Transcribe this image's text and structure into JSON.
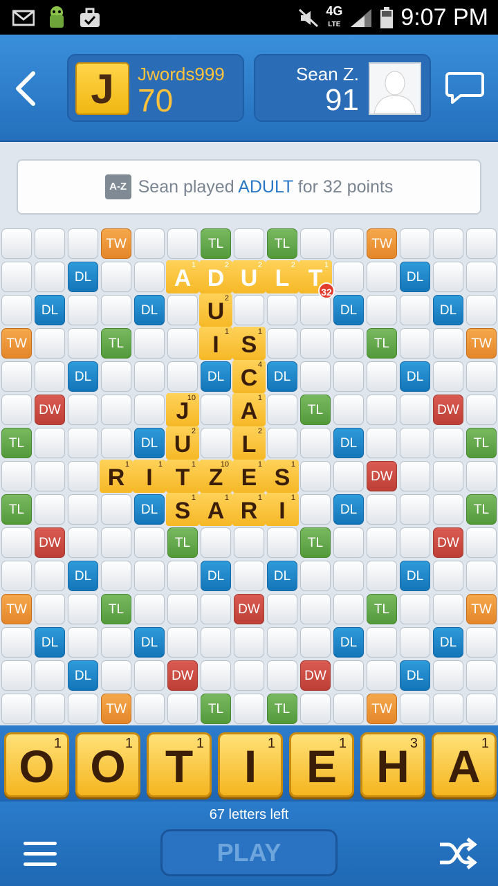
{
  "status_bar": {
    "time": "9:07 PM",
    "network": "4G",
    "network_sub": "LTE",
    "icons": [
      "mail-icon",
      "android-icon",
      "briefcase-check-icon",
      "mute-icon",
      "signal-icon",
      "battery-icon"
    ]
  },
  "players": {
    "me": {
      "initial": "J",
      "name": "Jwords999",
      "score": "70"
    },
    "opponent": {
      "name": "Sean Z.",
      "score": "91"
    }
  },
  "notice": {
    "icon_label": "A-Z",
    "prefix": "Sean played ",
    "word": "ADULT",
    "suffix": " for 32 points"
  },
  "colors": {
    "tw": "#e4862a",
    "tl": "#539a3c",
    "dl": "#1475b9",
    "dw": "#bd3e35",
    "header": "#2470bd",
    "tile": "#f6b826"
  },
  "board": {
    "size": 15,
    "bonus_rows": [
      "...TW..TL.TL..TW...",
      "x"
    ],
    "premium": [
      {
        "r": 0,
        "c": 3,
        "t": "TW"
      },
      {
        "r": 0,
        "c": 6,
        "t": "TL"
      },
      {
        "r": 0,
        "c": 8,
        "t": "TL"
      },
      {
        "r": 0,
        "c": 11,
        "t": "TW"
      },
      {
        "r": 1,
        "c": 2,
        "t": "DL"
      },
      {
        "r": 1,
        "c": 5,
        "t": "DW"
      },
      {
        "r": 1,
        "c": 9,
        "t": "DW"
      },
      {
        "r": 1,
        "c": 12,
        "t": "DL"
      },
      {
        "r": 2,
        "c": 1,
        "t": "DL"
      },
      {
        "r": 2,
        "c": 4,
        "t": "DL"
      },
      {
        "r": 2,
        "c": 10,
        "t": "DL"
      },
      {
        "r": 2,
        "c": 13,
        "t": "DL"
      },
      {
        "r": 3,
        "c": 0,
        "t": "TW"
      },
      {
        "r": 3,
        "c": 3,
        "t": "TL"
      },
      {
        "r": 3,
        "c": 7,
        "t": "TW"
      },
      {
        "r": 3,
        "c": 11,
        "t": "TL"
      },
      {
        "r": 3,
        "c": 14,
        "t": "TW"
      },
      {
        "r": 4,
        "c": 2,
        "t": "DL"
      },
      {
        "r": 4,
        "c": 6,
        "t": "DL"
      },
      {
        "r": 4,
        "c": 8,
        "t": "DL"
      },
      {
        "r": 4,
        "c": 12,
        "t": "DL"
      },
      {
        "r": 5,
        "c": 1,
        "t": "DW"
      },
      {
        "r": 5,
        "c": 5,
        "t": "TL"
      },
      {
        "r": 5,
        "c": 9,
        "t": "TL"
      },
      {
        "r": 5,
        "c": 13,
        "t": "DW"
      },
      {
        "r": 6,
        "c": 0,
        "t": "TL"
      },
      {
        "r": 6,
        "c": 4,
        "t": "DL"
      },
      {
        "r": 6,
        "c": 10,
        "t": "DL"
      },
      {
        "r": 6,
        "c": 14,
        "t": "TL"
      },
      {
        "r": 7,
        "c": 3,
        "t": "DW"
      },
      {
        "r": 7,
        "c": 11,
        "t": "DW"
      },
      {
        "r": 8,
        "c": 0,
        "t": "TL"
      },
      {
        "r": 8,
        "c": 4,
        "t": "DL"
      },
      {
        "r": 8,
        "c": 10,
        "t": "DL"
      },
      {
        "r": 8,
        "c": 14,
        "t": "TL"
      },
      {
        "r": 9,
        "c": 1,
        "t": "DW"
      },
      {
        "r": 9,
        "c": 5,
        "t": "TL"
      },
      {
        "r": 9,
        "c": 9,
        "t": "TL"
      },
      {
        "r": 9,
        "c": 13,
        "t": "DW"
      },
      {
        "r": 10,
        "c": 2,
        "t": "DL"
      },
      {
        "r": 10,
        "c": 6,
        "t": "DL"
      },
      {
        "r": 10,
        "c": 8,
        "t": "DL"
      },
      {
        "r": 10,
        "c": 12,
        "t": "DL"
      },
      {
        "r": 11,
        "c": 0,
        "t": "TW"
      },
      {
        "r": 11,
        "c": 3,
        "t": "TL"
      },
      {
        "r": 11,
        "c": 7,
        "t": "DW"
      },
      {
        "r": 11,
        "c": 11,
        "t": "TL"
      },
      {
        "r": 11,
        "c": 14,
        "t": "TW"
      },
      {
        "r": 12,
        "c": 1,
        "t": "DL"
      },
      {
        "r": 12,
        "c": 4,
        "t": "DL"
      },
      {
        "r": 12,
        "c": 10,
        "t": "DL"
      },
      {
        "r": 12,
        "c": 13,
        "t": "DL"
      },
      {
        "r": 13,
        "c": 2,
        "t": "DL"
      },
      {
        "r": 13,
        "c": 5,
        "t": "DW"
      },
      {
        "r": 13,
        "c": 9,
        "t": "DW"
      },
      {
        "r": 13,
        "c": 12,
        "t": "DL"
      },
      {
        "r": 14,
        "c": 3,
        "t": "TW"
      },
      {
        "r": 14,
        "c": 6,
        "t": "TL"
      },
      {
        "r": 14,
        "c": 8,
        "t": "TL"
      },
      {
        "r": 14,
        "c": 11,
        "t": "TW"
      }
    ],
    "tiles": [
      {
        "r": 1,
        "c": 5,
        "l": "A",
        "p": "1",
        "hl": true
      },
      {
        "r": 1,
        "c": 6,
        "l": "D",
        "p": "2",
        "hl": true
      },
      {
        "r": 1,
        "c": 7,
        "l": "U",
        "p": "2",
        "hl": true
      },
      {
        "r": 1,
        "c": 8,
        "l": "L",
        "p": "2",
        "hl": true
      },
      {
        "r": 1,
        "c": 9,
        "l": "T",
        "p": "1",
        "hl": true
      },
      {
        "r": 2,
        "c": 6,
        "l": "U",
        "p": "2",
        "hl": false
      },
      {
        "r": 3,
        "c": 6,
        "l": "I",
        "p": "1",
        "hl": false
      },
      {
        "r": 3,
        "c": 7,
        "l": "S",
        "p": "1",
        "hl": false
      },
      {
        "r": 4,
        "c": 7,
        "l": "C",
        "p": "4",
        "hl": false
      },
      {
        "r": 5,
        "c": 5,
        "l": "J",
        "p": "10",
        "hl": false
      },
      {
        "r": 5,
        "c": 7,
        "l": "A",
        "p": "1",
        "hl": false
      },
      {
        "r": 6,
        "c": 5,
        "l": "U",
        "p": "2",
        "hl": false
      },
      {
        "r": 6,
        "c": 7,
        "l": "L",
        "p": "2",
        "hl": false
      },
      {
        "r": 7,
        "c": 3,
        "l": "R",
        "p": "1",
        "hl": false
      },
      {
        "r": 7,
        "c": 4,
        "l": "I",
        "p": "1",
        "hl": false
      },
      {
        "r": 7,
        "c": 5,
        "l": "T",
        "p": "1",
        "hl": false
      },
      {
        "r": 7,
        "c": 6,
        "l": "Z",
        "p": "10",
        "hl": false
      },
      {
        "r": 7,
        "c": 7,
        "l": "E",
        "p": "1",
        "hl": false
      },
      {
        "r": 7,
        "c": 8,
        "l": "S",
        "p": "1",
        "hl": false
      },
      {
        "r": 8,
        "c": 5,
        "l": "S",
        "p": "1",
        "hl": false
      },
      {
        "r": 8,
        "c": 6,
        "l": "A",
        "p": "1",
        "hl": false
      },
      {
        "r": 8,
        "c": 7,
        "l": "R",
        "p": "1",
        "hl": false
      },
      {
        "r": 8,
        "c": 8,
        "l": "I",
        "p": "1",
        "hl": false
      }
    ],
    "last_play_badge": "32"
  },
  "rack": [
    {
      "l": "O",
      "p": "1"
    },
    {
      "l": "O",
      "p": "1"
    },
    {
      "l": "T",
      "p": "1"
    },
    {
      "l": "I",
      "p": "1"
    },
    {
      "l": "E",
      "p": "1"
    },
    {
      "l": "H",
      "p": "3"
    },
    {
      "l": "A",
      "p": "1"
    }
  ],
  "footer": {
    "letters_left": "67 letters left",
    "play_label": "PLAY"
  }
}
